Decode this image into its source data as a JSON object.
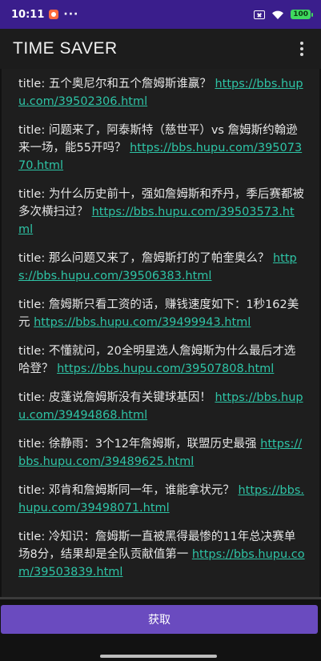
{
  "status_bar": {
    "time": "10:11",
    "more": "···",
    "battery": "100"
  },
  "app_bar": {
    "title": "TIME SAVER"
  },
  "items": [
    {
      "prefix": "title: 五个奥尼尔和五个詹姆斯谁赢？",
      "link": "https://bbs.hupu.com/39502306.html"
    },
    {
      "prefix": "title: 问题来了，阿泰斯特（慈世平）vs 詹姆斯约翰逊来一场，能55开吗？",
      "link": "https://bbs.hupu.com/39507370.html"
    },
    {
      "prefix": "title: 为什么历史前十，强如詹姆斯和乔丹，季后赛都被多次横扫过？",
      "link": "https://bbs.hupu.com/39503573.html"
    },
    {
      "prefix": "title: 那么问题又来了，詹姆斯打的了帕奎奥么？",
      "link": "https://bbs.hupu.com/39506383.html"
    },
    {
      "prefix": "title: 詹姆斯只看工资的话，赚钱速度如下：1秒162美元",
      "link": "https://bbs.hupu.com/39499943.html"
    },
    {
      "prefix": "title: 不懂就问，20全明星选人詹姆斯为什么最后才选哈登？",
      "link": "https://bbs.hupu.com/39507808.html"
    },
    {
      "prefix": "title: 皮蓬说詹姆斯没有关键球基因！",
      "link": "https://bbs.hupu.com/39494868.html"
    },
    {
      "prefix": "title: 徐静雨：3个12年詹姆斯，联盟历史最强",
      "link": "https://bbs.hupu.com/39489625.html"
    },
    {
      "prefix": "title: 邓肯和詹姆斯同一年，谁能拿状元？",
      "link": "https://bbs.hupu.com/39498071.html"
    },
    {
      "prefix": "title: 冷知识：詹姆斯一直被黑得最惨的11年总决赛单场8分，结果却是全队贡献值第一",
      "link": "https://bbs.hupu.com/39503839.html"
    }
  ],
  "fetch_button": {
    "label": "获取"
  },
  "colors": {
    "status_bar": "#3a1e8c",
    "accent": "#6a4bbf",
    "link": "#2ec4a6"
  }
}
